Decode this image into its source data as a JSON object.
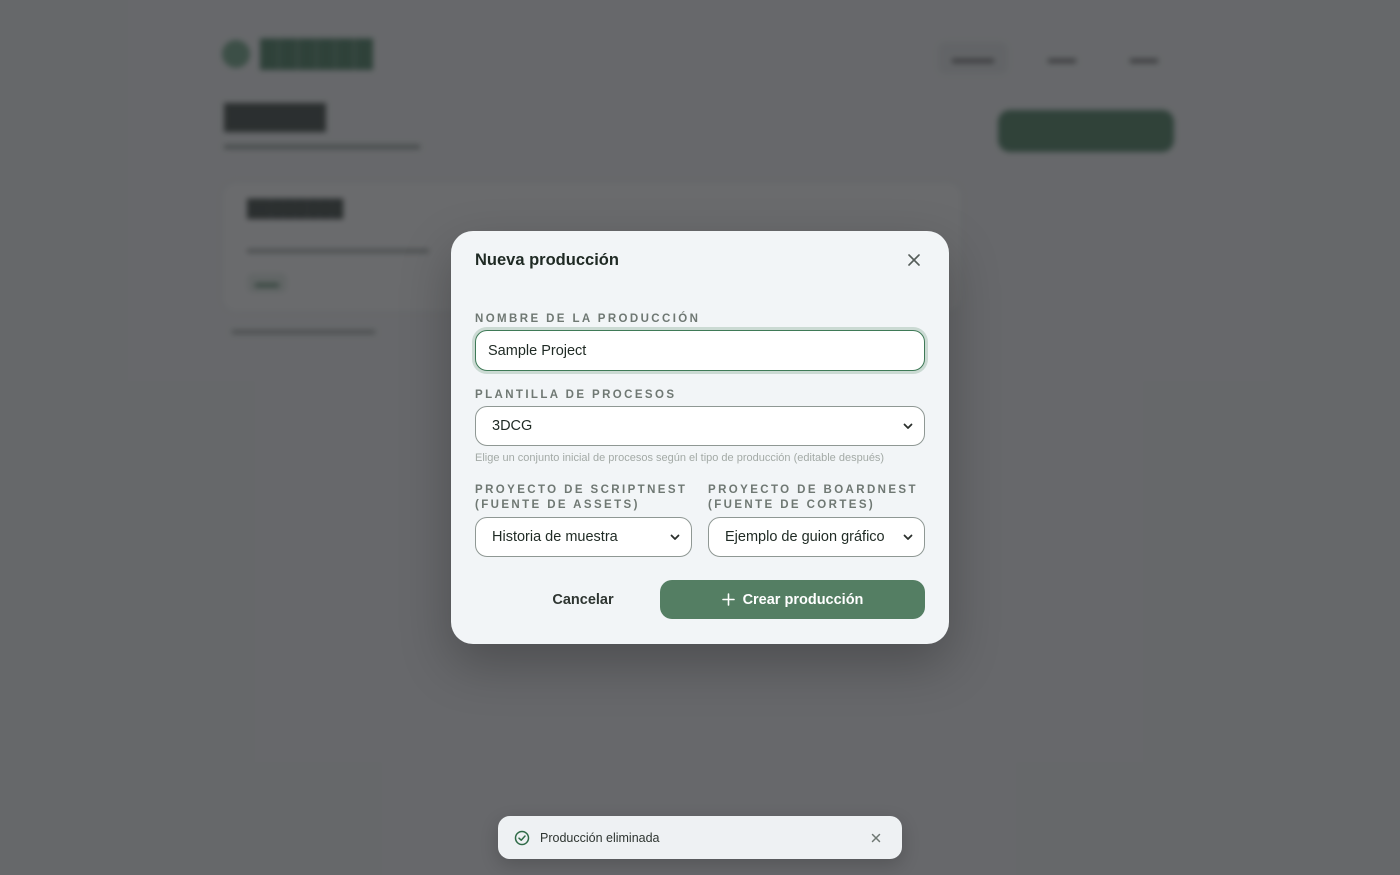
{
  "modal": {
    "title": "Nueva producción",
    "name_field": {
      "label": "NOMBRE DE LA PRODUCCIÓN",
      "value": "Sample Project"
    },
    "template_field": {
      "label": "PLANTILLA DE PROCESOS",
      "selected": "3DCG",
      "hint": "Elige un conjunto inicial de procesos según el tipo de producción (editable después)"
    },
    "scriptnest_field": {
      "label_line1": "PROYECTO DE SCRIPTNEST",
      "label_line2": "(FUENTE DE ASSETS)",
      "selected": "Historia de muestra"
    },
    "boardnest_field": {
      "label_line1": "PROYECTO DE BOARDNEST",
      "label_line2": "(FUENTE DE CORTES)",
      "selected": "Ejemplo de guion gráfico"
    },
    "cancel_label": "Cancelar",
    "create_label": "Crear producción"
  },
  "toast": {
    "message": "Producción eliminada"
  },
  "colors": {
    "accent": "#547e63",
    "focus_ring": "#3f7a57",
    "overlay": "#303234"
  },
  "icons": {
    "close": "close-icon",
    "select_arrow": "chevron-down-icon",
    "create": "plus-icon",
    "toast_status": "check-circle-icon"
  }
}
